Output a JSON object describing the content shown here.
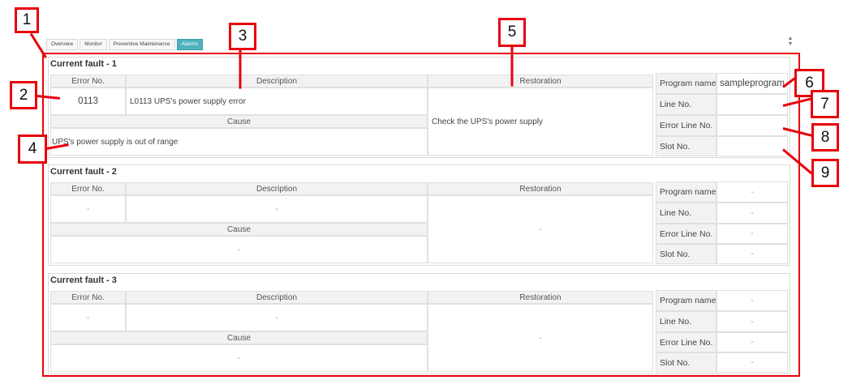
{
  "tabs": [
    {
      "label": "Overview",
      "active": false
    },
    {
      "label": "Monitor",
      "active": false
    },
    {
      "label": "Preventive Maintenance",
      "active": false
    },
    {
      "label": "Alarms",
      "active": true
    }
  ],
  "scroll_icon": "up-down-arrows-icon",
  "headers": {
    "error_no": "Error No.",
    "description": "Description",
    "restoration": "Restoration",
    "cause": "Cause",
    "program_name": "Program name",
    "line_no": "Line No.",
    "error_line_no": "Error Line No.",
    "slot_no": "Slot No."
  },
  "faults": [
    {
      "title": "Current fault - 1",
      "error_no": "0113",
      "description": "L0113 UPS's power supply error",
      "cause": "UPS's power supply is out of range",
      "restoration": "Check the UPS's power supply",
      "program_name": "sampleprogram",
      "line_no": "",
      "error_line_no": "",
      "slot_no": ""
    },
    {
      "title": "Current fault - 2",
      "error_no": "-",
      "description": "-",
      "cause": "-",
      "restoration": "-",
      "program_name": "-",
      "line_no": "-",
      "error_line_no": "-",
      "slot_no": "-"
    },
    {
      "title": "Current fault - 3",
      "error_no": "-",
      "description": "-",
      "cause": "-",
      "restoration": "-",
      "program_name": "-",
      "line_no": "-",
      "error_line_no": "-",
      "slot_no": "-"
    }
  ],
  "callouts": [
    "1",
    "2",
    "3",
    "4",
    "5",
    "6",
    "7",
    "8",
    "9"
  ],
  "colors": {
    "callout_red": "#e8000d",
    "active_tab": "#4fb3bf",
    "header_bg": "#f2f2f2"
  }
}
